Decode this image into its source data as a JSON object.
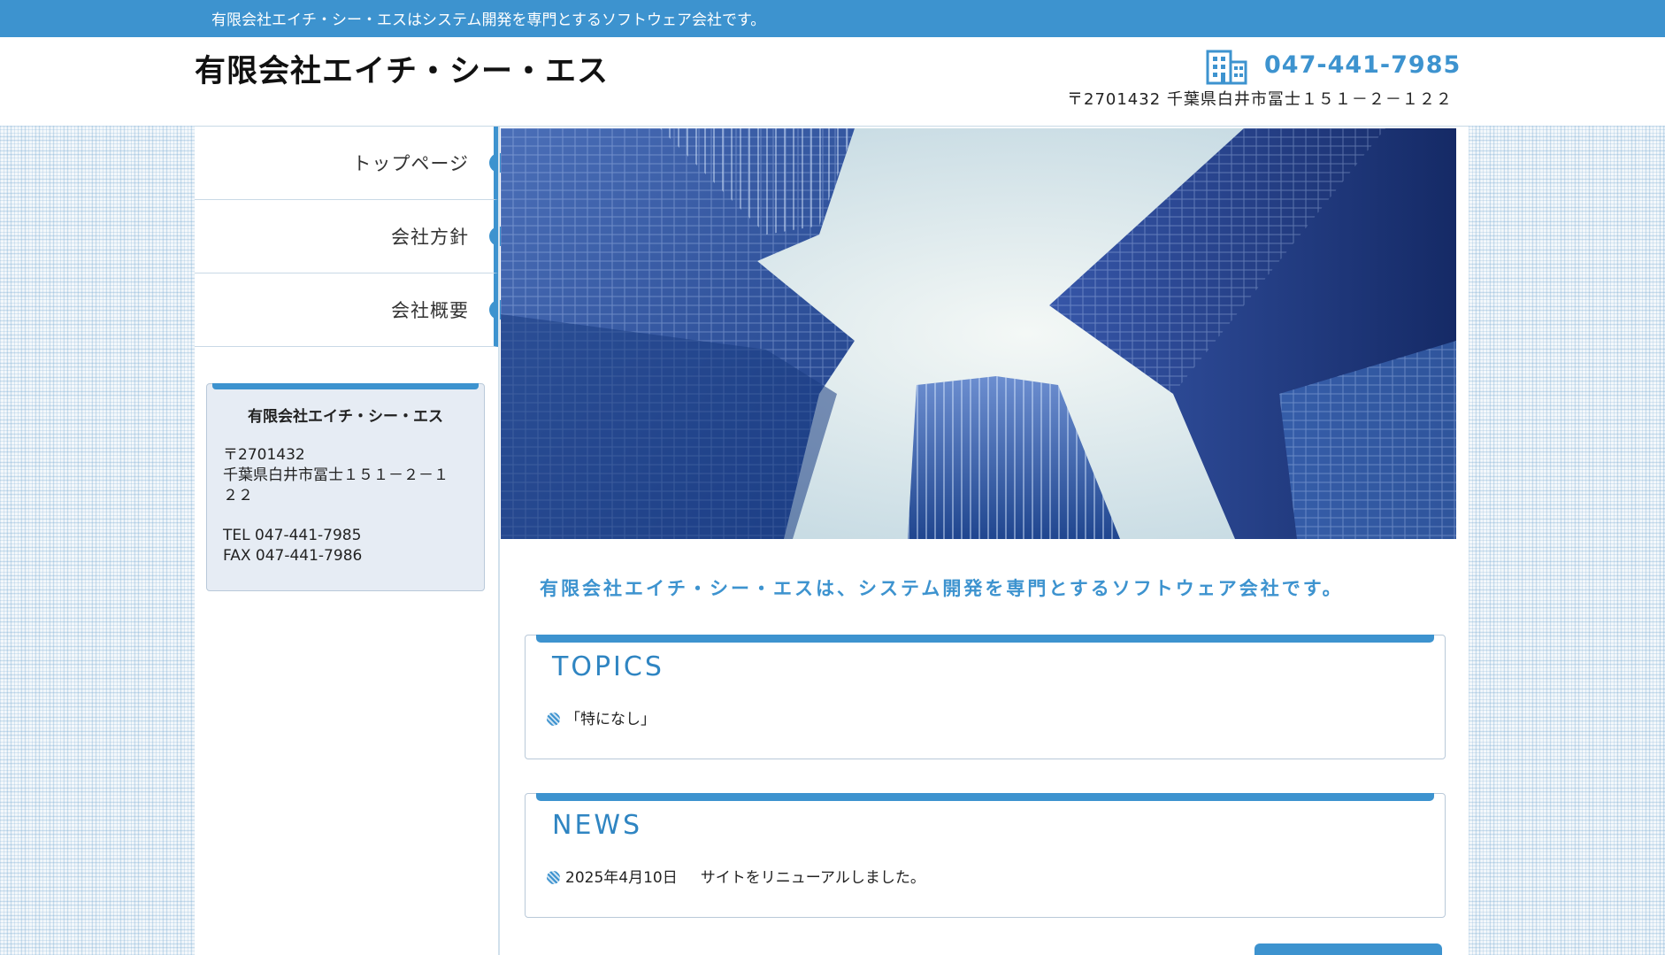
{
  "topbar": {
    "tagline": "有限会社エイチ・シー・エスはシステム開発を専門とするソフトウェア会社です。"
  },
  "header": {
    "logo": "有限会社エイチ・シー・エス",
    "phone": "047-441-7985",
    "phone_icon": "building-icon",
    "address": "〒2701432 千葉県白井市冨士１５１－２－１２２"
  },
  "nav": {
    "items": [
      {
        "label": "トップページ"
      },
      {
        "label": "会社方針"
      },
      {
        "label": "会社概要"
      }
    ]
  },
  "infobox": {
    "title": "有限会社エイチ・シー・エス",
    "postal": "〒2701432",
    "address_line1": "千葉県白井市冨士１５１－２－１",
    "address_line2": "２２",
    "tel": "TEL 047-441-7985",
    "fax": "FAX 047-441-7986"
  },
  "main": {
    "lead": "有限会社エイチ・シー・エスは、システム開発を専門とするソフトウェア会社です。",
    "topics": {
      "title": "TOPICS",
      "items": [
        {
          "text": "「特になし」"
        }
      ]
    },
    "news": {
      "title": "NEWS",
      "items": [
        {
          "date": "2025年4月10日",
          "text": "サイトをリニューアルしました。"
        }
      ]
    }
  },
  "colors": {
    "accent": "#3d93cf",
    "heading": "#2f85c2",
    "panel_border": "#b9c9d9",
    "infobox_bg": "#e6ecf4"
  }
}
